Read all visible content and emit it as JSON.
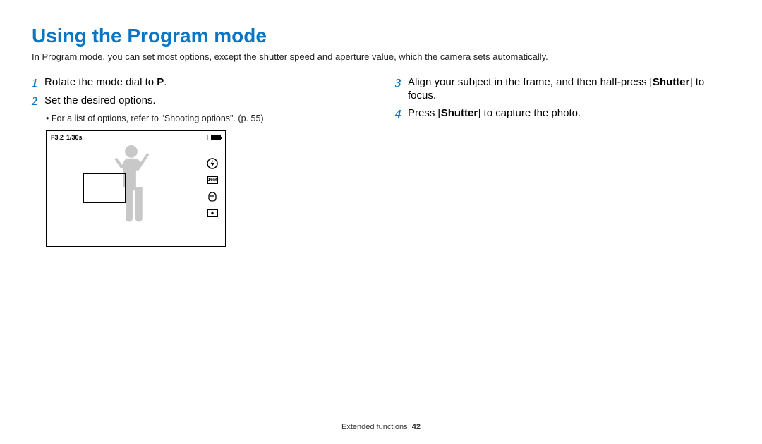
{
  "title": "Using the Program mode",
  "intro": "In Program mode, you can set most options, except the shutter speed and aperture value, which the camera sets automatically.",
  "left": {
    "step1": {
      "num": "1",
      "pre": "Rotate the mode dial to ",
      "mode": "P",
      "post": "."
    },
    "step2": {
      "num": "2",
      "text": "Set the desired options."
    },
    "bullet": "For a list of options, refer to \"Shooting options\". (p. 55)",
    "screen": {
      "aperture": "F3.2",
      "shutter": "1/30s",
      "iso_label": "I",
      "size_label": "16M"
    }
  },
  "right": {
    "step3": {
      "num": "3",
      "pre": "Align your subject in the frame, and then half-press [",
      "bold": "Shutter",
      "post": "] to focus."
    },
    "step4": {
      "num": "4",
      "pre": "Press [",
      "bold": "Shutter",
      "post": "] to capture the photo."
    }
  },
  "footer": {
    "section": "Extended functions",
    "page": "42"
  }
}
